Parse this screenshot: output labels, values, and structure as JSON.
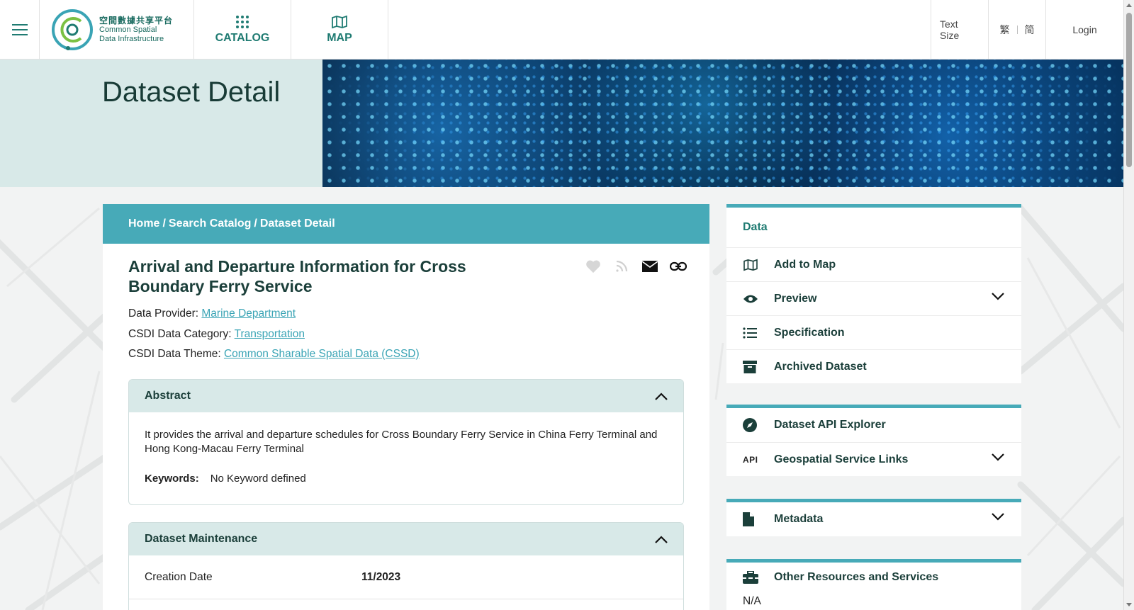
{
  "header": {
    "logo": {
      "cn": "空間數據共享平台",
      "en_line1": "Common Spatial",
      "en_line2": "Data Infrastructure"
    },
    "nav": [
      {
        "label": "CATALOG",
        "icon": "grid-dots-icon"
      },
      {
        "label": "MAP",
        "icon": "map-icon"
      }
    ],
    "text_size": "Text Size",
    "lang_trad": "繁",
    "lang_simp": "简",
    "login": "Login"
  },
  "hero": {
    "title": "Dataset Detail"
  },
  "breadcrumb": {
    "home": "Home",
    "sep1": "/",
    "search": "Search Catalog",
    "sep2": "/",
    "current": "Dataset Detail"
  },
  "dataset": {
    "title": "Arrival and Departure Information for Cross Boundary Ferry Service",
    "provider_label": "Data Provider:",
    "provider": "Marine Department",
    "category_label": "CSDI Data Category:",
    "category": "Transportation",
    "theme_label": "CSDI Data Theme:",
    "theme": "Common Sharable Spatial Data (CSSD)"
  },
  "abstract": {
    "heading": "Abstract",
    "text": "It provides the arrival and departure schedules for Cross Boundary Ferry Service in China Ferry Terminal and Hong Kong-Macau Ferry Terminal",
    "keywords_label": "Keywords:",
    "keywords": "No Keyword defined"
  },
  "maintenance": {
    "heading": "Dataset Maintenance",
    "rows": [
      {
        "label": "Creation Date",
        "value": "11/2023"
      }
    ]
  },
  "sidebar": {
    "data_caption": "Data",
    "data_items": [
      {
        "label": "Add to Map",
        "icon": "map-icon",
        "expandable": false
      },
      {
        "label": "Preview",
        "icon": "eye-icon",
        "expandable": true
      },
      {
        "label": "Specification",
        "icon": "list-icon",
        "expandable": false
      },
      {
        "label": "Archived Dataset",
        "icon": "archive-box-icon",
        "expandable": false
      }
    ],
    "api_items": [
      {
        "label": "Dataset API Explorer",
        "icon": "compass-icon",
        "expandable": false
      },
      {
        "label": "Geospatial Service Links",
        "icon": "api-icon",
        "icon_text": "API",
        "expandable": true
      }
    ],
    "metadata": {
      "label": "Metadata",
      "icon": "file-icon",
      "expandable": true
    },
    "other": {
      "label": "Other Resources and Services",
      "icon": "toolbox-icon",
      "value": "N/A"
    }
  },
  "colors": {
    "accent": "#47aab8",
    "heading": "#1b3f3a",
    "link": "#3aa4b5",
    "hero_bg": "#d8e9e8"
  }
}
